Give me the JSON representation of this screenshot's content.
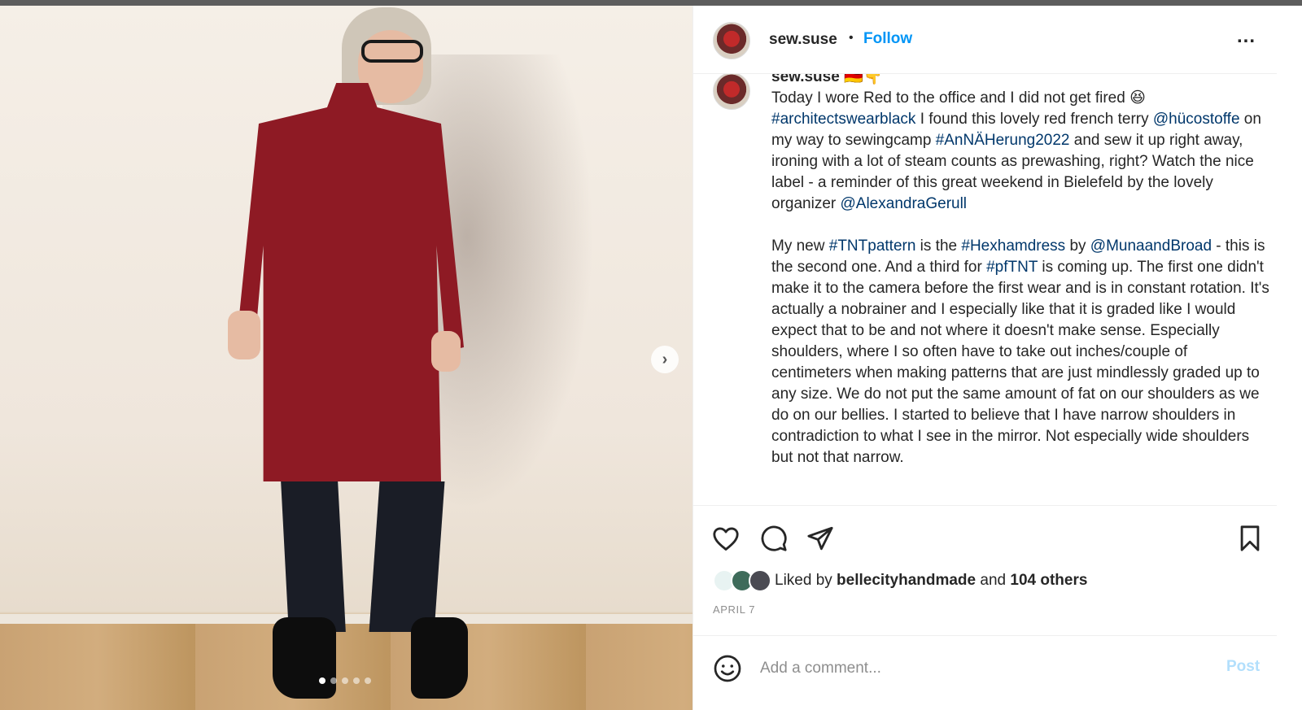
{
  "post": {
    "username": "sew.suse",
    "separator": "•",
    "follow_label": "Follow",
    "more_label": "...",
    "caption": {
      "username": "sew.suse",
      "flag_emoji": "🇩🇪👇",
      "p1_a": "Today I wore Red to the office and I did not get fired 😆 ",
      "tag_architects": "#architectswearblack",
      "p1_b": " I found this lovely red french terry ",
      "mention_hucostoffe": "@hücostoffe",
      "p1_c": " on my way to sewingcamp ",
      "tag_annaherung": "#AnNÄHerung2022",
      "p1_d": " and sew it up right away, ironing with a lot of steam counts as prewashing, right? Watch the nice label - a reminder of this great weekend in Bielefeld by the lovely organizer ",
      "mention_alexandra": "@AlexandraGerull",
      "p2_a": "My new ",
      "tag_tntpattern": "#TNTpattern",
      "p2_b": " is the ",
      "tag_hexham": "#Hexhamdress",
      "p2_c": " by ",
      "mention_muna": "@MunaandBroad",
      "p2_d": " - this is the second one. And a third for ",
      "tag_pftnt": "#pfTNT",
      "p2_e": " is coming up. The first one didn't make it to the camera before the first wear and is in constant rotation. It's actually a nobrainer and I especially like that it is graded like I would expect that to be and not where it doesn't make sense. Especially shoulders, where I so often have to take out inches/couple of centimeters when making patterns that are just mindlessly graded up to any size. We do not put the same amount of fat on our shoulders as we do on our bellies. I started to believe that I have narrow shoulders in contradiction to what I see in the mirror. Not especially wide shoulders but not that narrow."
    },
    "likes": {
      "prefix": "Liked by ",
      "user": "bellecityhandmade",
      "middle": " and ",
      "others": "104 others"
    },
    "date": "APRIL 7",
    "comment": {
      "placeholder": "Add a comment...",
      "post_label": "Post"
    },
    "carousel": {
      "total_slides": 5,
      "active_slide": 1,
      "next_label": "›"
    }
  },
  "colors": {
    "accent": "#0095f6",
    "link": "#00376b",
    "muted": "#8e8e8e",
    "post_disabled": "#b2dffc",
    "dress": "#8e1a24"
  },
  "icons": [
    "heart-icon",
    "comment-icon",
    "share-icon",
    "bookmark-icon",
    "emoji-icon",
    "more-icon",
    "chevron-right-icon"
  ]
}
